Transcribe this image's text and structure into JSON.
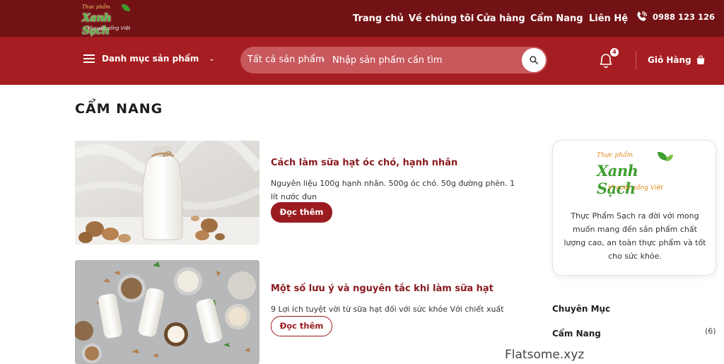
{
  "logo": {
    "script": "Thực phẩm",
    "brand": "Xanh Sạch",
    "tagline": "Vì cuộc sống Việt"
  },
  "topnav": {
    "items": [
      "Trang chủ",
      "Về chúng tôi",
      "Cửa hàng",
      "Cẩm Nang",
      "Liên Hệ"
    ],
    "phone": "0988 123 126"
  },
  "mainbar": {
    "category_menu": "Danh mục sản phẩm",
    "search_category": "Tất cả sản phẩm",
    "search_placeholder": "Nhập sản phẩm cần tìm",
    "notification_count": "4",
    "cart_label": "Giỏ Hàng"
  },
  "page": {
    "title": "CẨM NANG"
  },
  "posts": [
    {
      "title": "Cách làm sữa hạt óc chó, hạnh nhân",
      "excerpt": "Nguyên liệu 100g hạnh nhân. 500g óc chó. 50g đường phèn. 1 lít nước đun",
      "button": "Đọc thêm"
    },
    {
      "title": "Một số lưu ý và nguyên tắc khi làm sữa hạt",
      "excerpt": "9 Lợi ích tuyệt vời từ sữa hạt đối với sức khỏe Với chiết xuất",
      "button": "Đọc thêm"
    }
  ],
  "sidebar": {
    "about_text": "Thực Phẩm Sạch ra đời với mong muốn mang đến sản phẩm chất lượng cao, an toàn thực phẩm và tốt cho sức khỏe.",
    "categories_heading": "Chuyên Mục",
    "categories": [
      {
        "label": "Cẩm Nang",
        "count": "(6)"
      }
    ]
  },
  "watermark": "Flatsome.xyz",
  "colors": {
    "topbar": "#731215",
    "mainbar": "#a61d22",
    "accent": "#9b1c20",
    "brand_green": "#3e9e30"
  }
}
